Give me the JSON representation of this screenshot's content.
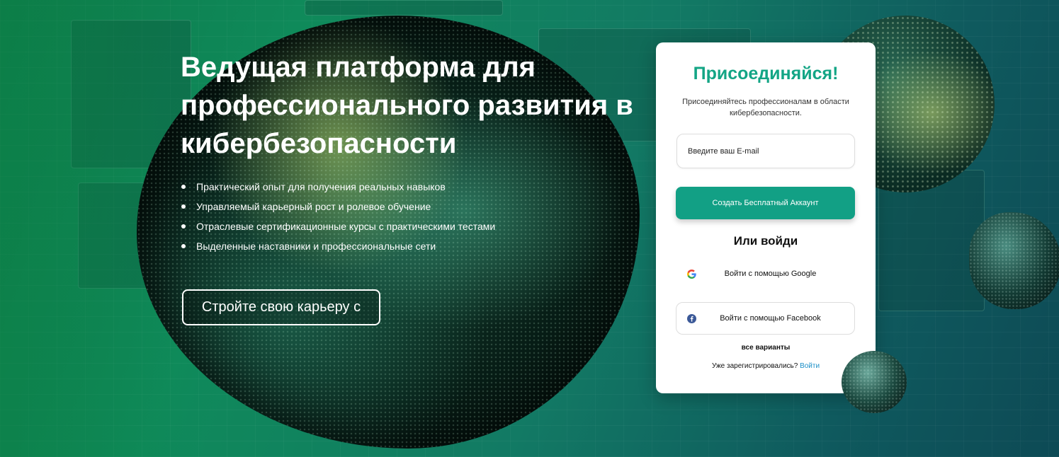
{
  "hero": {
    "title": "Ведущая платформа для профессионального развития в кибербезопасности",
    "bullets": [
      "Практический опыт для получения реальных навыков",
      "Управляемый карьерный рост и ролевое обучение",
      "Отраслевые сертификационные курсы с практическими тестами",
      "Выделенные наставники и профессиональные сети"
    ],
    "cta_label": "Стройте свою карьеру с"
  },
  "signup": {
    "title": "Присоединяйся!",
    "subtitle": "Присоединяйтесь профессионалам в области кибербезопасности.",
    "email_placeholder": "Введите ваш E-mail",
    "create_account_label": "Создать Бесплатный Аккаунт",
    "or_label": "Или войди",
    "google_label": "Войти с помощью Google",
    "google_icon": "google-icon",
    "facebook_label": "Войти с помощью Facebook",
    "facebook_icon": "facebook-icon",
    "all_options_label": "все варианты",
    "already_registered_text": "Уже зарегистрировались?",
    "login_link_label": "Войти"
  },
  "colors": {
    "accent": "#12a085",
    "title_green": "#13a585",
    "link": "#1b8fc7",
    "facebook_blue": "#3b5998"
  }
}
